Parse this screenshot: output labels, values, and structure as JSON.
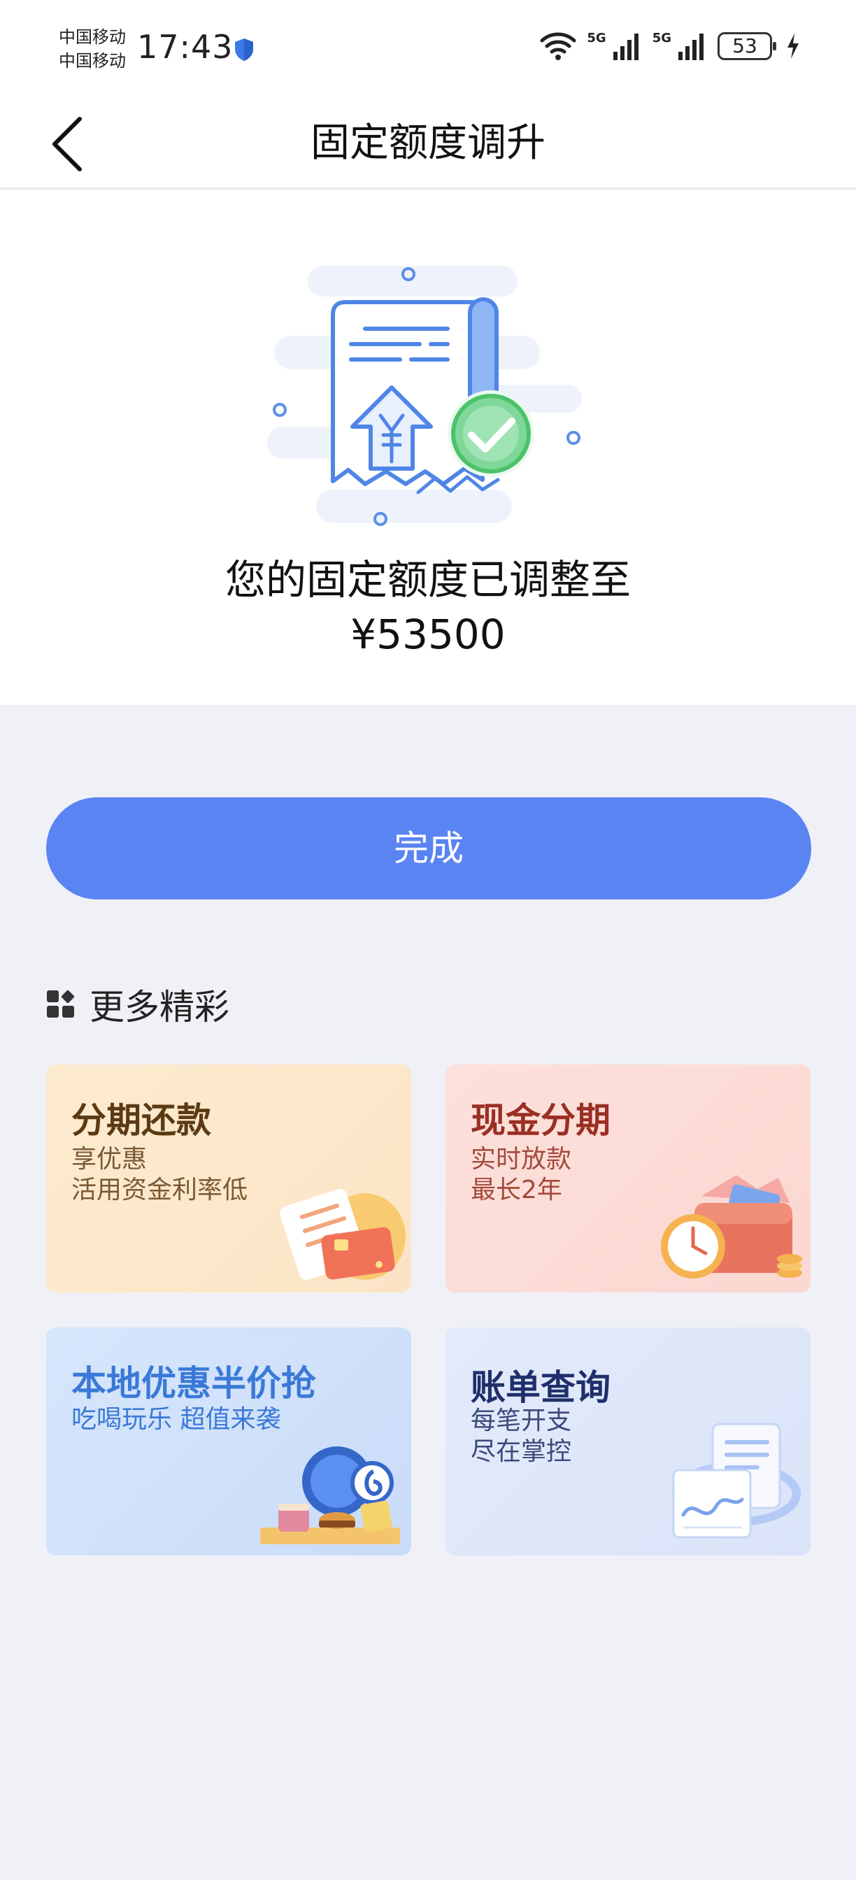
{
  "status_bar": {
    "carrier1": "中国移动",
    "carrier2": "中国移动",
    "time": "17:43",
    "sig1_label": "5G",
    "sig2_label": "5G",
    "battery": "53"
  },
  "nav": {
    "title": "固定额度调升"
  },
  "result": {
    "line1": "您的固定额度已调整至",
    "amount": "¥53500"
  },
  "done_button": "完成",
  "more": {
    "title": "更多精彩",
    "cards": [
      {
        "title": "分期还款",
        "sub1": "享优惠",
        "sub2": "活用资金利率低"
      },
      {
        "title": "现金分期",
        "sub1": "实时放款",
        "sub2": "最长2年"
      },
      {
        "title": "本地优惠半价抢",
        "sub1": "吃喝玩乐 超值来袭"
      },
      {
        "title": "账单查询",
        "sub1": "每笔开支",
        "sub2": "尽在掌控"
      }
    ]
  },
  "colors": {
    "accent": "#5b84f3",
    "background": "#eff1f7",
    "success": "#4cc26a"
  }
}
